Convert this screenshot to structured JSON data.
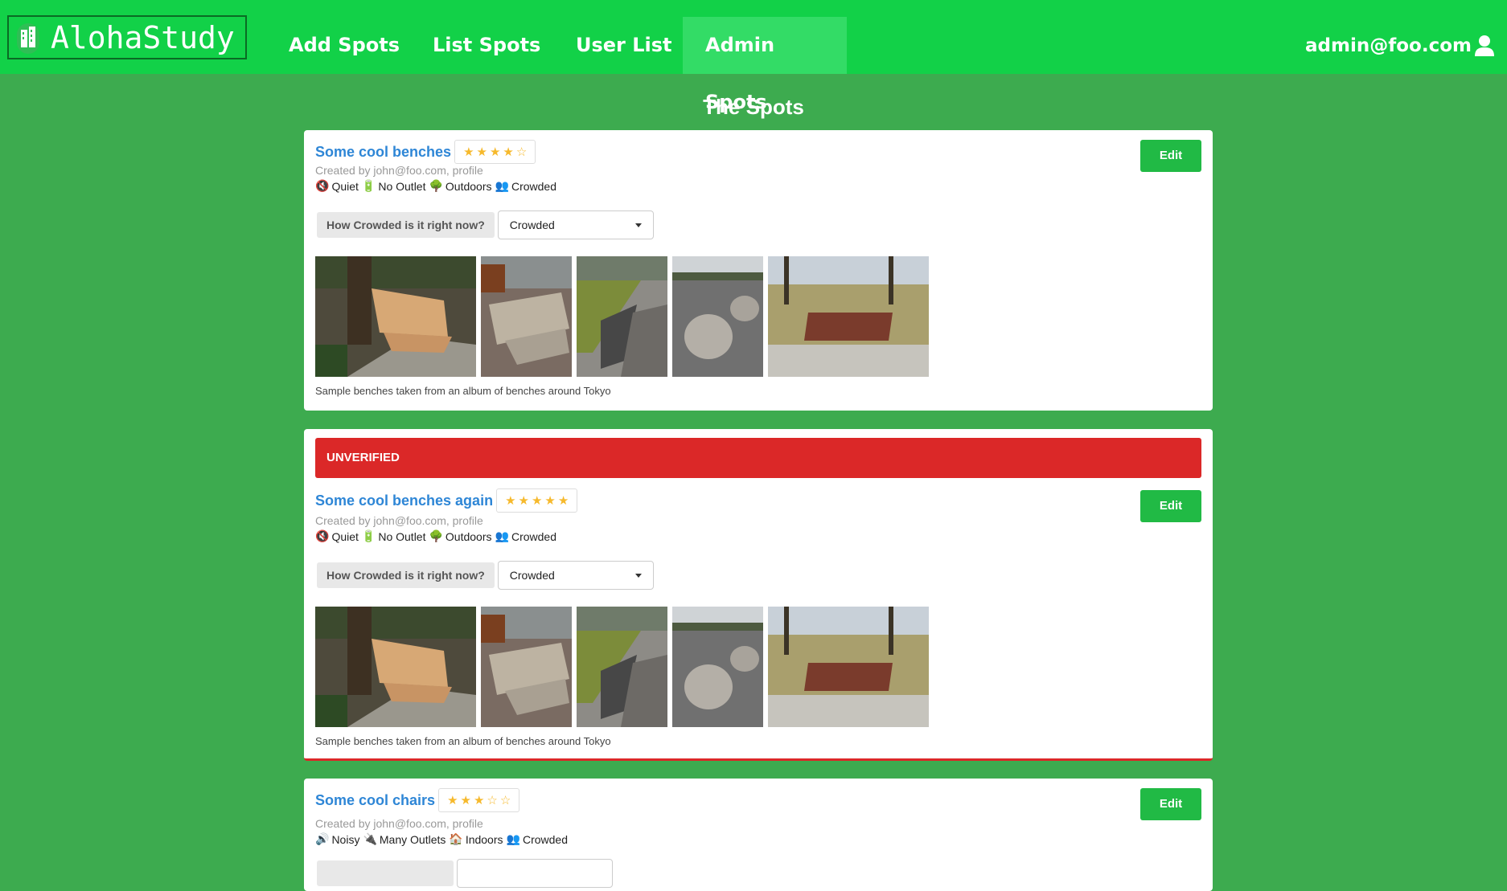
{
  "app": {
    "name": "AlohaStudy"
  },
  "nav": [
    {
      "label": "Add Spots"
    },
    {
      "label": "List Spots"
    },
    {
      "label": "User List"
    },
    {
      "label": "Admin Spots",
      "active": true
    }
  ],
  "user": {
    "email": "admin@foo.com"
  },
  "page": {
    "title": "The Spots"
  },
  "colors": {
    "nav": "#12d148",
    "background": "#3dab4f",
    "accent": "#21ba45",
    "danger": "#db2828",
    "link": "#2e86d6"
  },
  "spots": [
    {
      "name": "Some cool benches",
      "rating": 4,
      "rating_max": 5,
      "creator": "Created by john@foo.com, profile",
      "tags": [
        {
          "icon": "speaker-mute-icon",
          "label": "Quiet"
        },
        {
          "icon": "battery-icon",
          "label": "No Outlet"
        },
        {
          "icon": "tree-icon",
          "label": "Outdoors"
        },
        {
          "icon": "people-icon",
          "label": "Crowded"
        }
      ],
      "crowd_label": "How Crowded is it right now?",
      "crowd_value": "Crowded",
      "caption": "Sample benches taken from an album of benches around Tokyo",
      "edit": "Edit",
      "unverified": false
    },
    {
      "name": "Some cool benches again",
      "rating": 5,
      "rating_max": 5,
      "creator": "Created by john@foo.com, profile",
      "tags": [
        {
          "icon": "speaker-mute-icon",
          "label": "Quiet"
        },
        {
          "icon": "battery-icon",
          "label": "No Outlet"
        },
        {
          "icon": "tree-icon",
          "label": "Outdoors"
        },
        {
          "icon": "people-icon",
          "label": "Crowded"
        }
      ],
      "crowd_label": "How Crowded is it right now?",
      "crowd_value": "Crowded",
      "caption": "Sample benches taken from an album of benches around Tokyo",
      "edit": "Edit",
      "unverified": true,
      "banner": "UNVERIFIED"
    },
    {
      "name": "Some cool chairs",
      "rating": 3,
      "rating_max": 5,
      "creator": "Created by john@foo.com, profile",
      "tags": [
        {
          "icon": "speaker-loud-icon",
          "label": "Noisy"
        },
        {
          "icon": "plug-icon",
          "label": "Many Outlets"
        },
        {
          "icon": "house-icon",
          "label": "Indoors"
        },
        {
          "icon": "people-icon",
          "label": "Crowded"
        }
      ],
      "edit": "Edit",
      "unverified": false
    }
  ]
}
